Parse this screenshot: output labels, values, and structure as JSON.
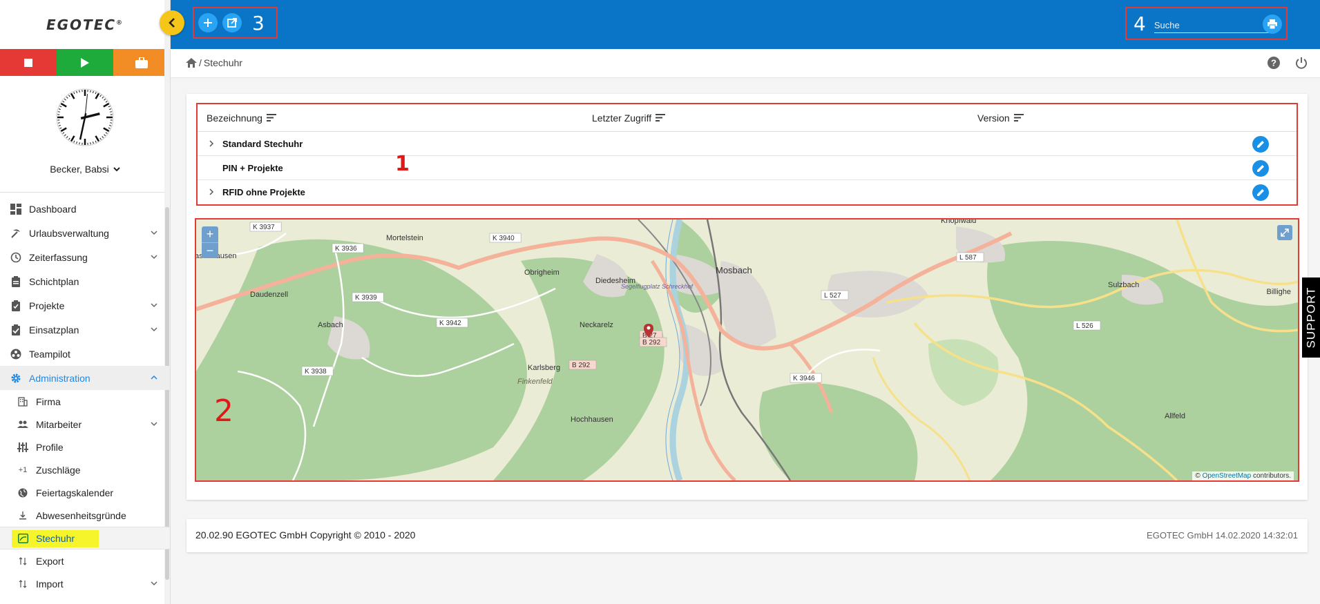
{
  "app": {
    "logo": "EGOTEC",
    "logo_mark": "®"
  },
  "sidebar": {
    "user_name": "Becker, Babsi",
    "items": [
      {
        "label": "Dashboard"
      },
      {
        "label": "Urlaubsverwaltung"
      },
      {
        "label": "Zeiterfassung"
      },
      {
        "label": "Schichtplan"
      },
      {
        "label": "Projekte"
      },
      {
        "label": "Einsatzplan"
      },
      {
        "label": "Teampilot"
      },
      {
        "label": "Administration"
      }
    ],
    "subitems": [
      {
        "label": "Firma"
      },
      {
        "label": "Mitarbeiter"
      },
      {
        "label": "Profile"
      },
      {
        "label": "Zuschläge"
      },
      {
        "label": "Feiertagskalender"
      },
      {
        "label": "Abwesenheitsgründe"
      },
      {
        "label": "Stechuhr"
      },
      {
        "label": "Export"
      },
      {
        "label": "Import"
      }
    ],
    "clock": {
      "hour": 2,
      "minute": 32,
      "second": 1
    }
  },
  "header": {
    "annot_3": "3",
    "annot_4": "4",
    "search_placeholder": "Suche"
  },
  "breadcrumb": {
    "separator": "/",
    "current": "Stechuhr"
  },
  "table": {
    "columns": [
      "Bezeichnung",
      "Letzter Zugriff",
      "Version"
    ],
    "rows": [
      {
        "name": "Standard Stechuhr",
        "expandable": true
      },
      {
        "name": "PIN + Projekte",
        "expandable": false
      },
      {
        "name": "RFID ohne Projekte",
        "expandable": true
      }
    ],
    "annot_1": "1"
  },
  "map": {
    "annot_2": "2",
    "places": [
      "Mortelstein",
      "Obrigheim",
      "Diedesheim",
      "Mosbach",
      "Sulzbach",
      "asterhausen",
      "Daudenzell",
      "Asbach",
      "Neckarelz",
      "Karlsberg",
      "Finkenfeld",
      "Hochhausen",
      "Allfeld",
      "Billighe",
      "Knopfwald",
      "Segelflugplatz Schreckhof"
    ],
    "roads": [
      "K 3937",
      "K 3936",
      "K 3940",
      "K 3939",
      "K 3942",
      "K 3938",
      "B 292",
      "B 27",
      "B 292",
      "K 3946",
      "L 587",
      "L 527",
      "L 526"
    ],
    "zoom_in": "+",
    "zoom_out": "−",
    "attribution_prefix": "©",
    "attribution_link": "OpenStreetMap",
    "attribution_suffix": "contributors."
  },
  "footer": {
    "left": "20.02.90 EGOTEC GmbH Copyright © 2010 - 2020",
    "right": "EGOTEC GmbH  14.02.2020 14:32:01"
  },
  "support": "SUPPORT"
}
